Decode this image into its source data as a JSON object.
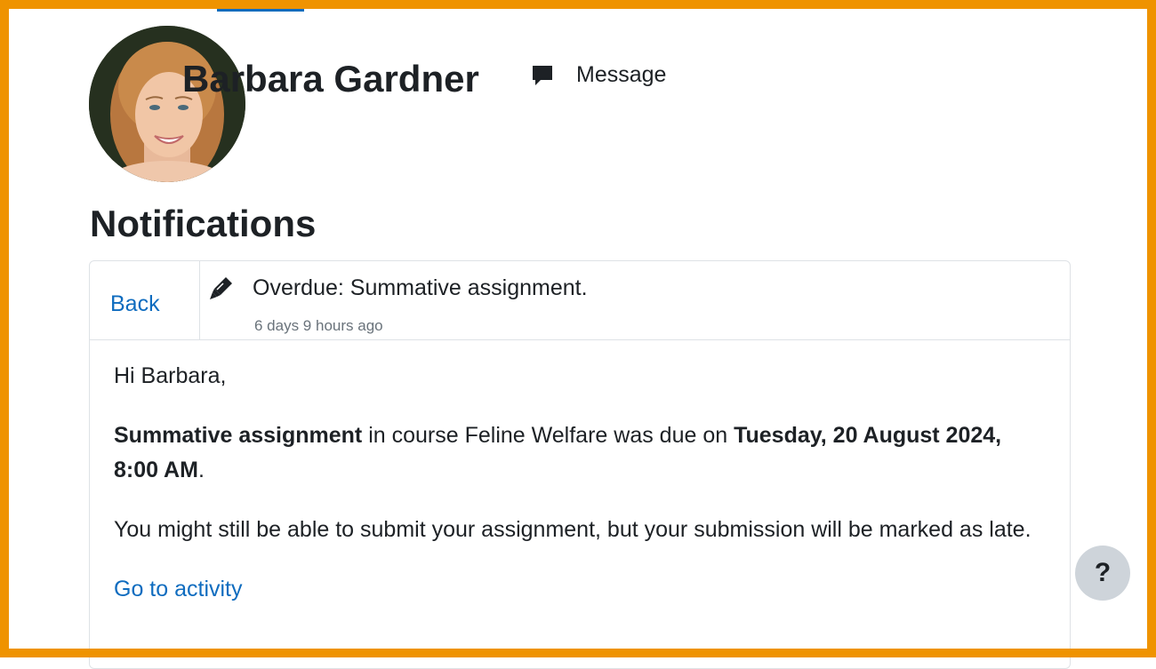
{
  "profile": {
    "name": "Barbara Gardner",
    "message_label": "Message",
    "avatar_icon": "profile-photo"
  },
  "page": {
    "title": "Notifications"
  },
  "notification": {
    "back_label": "Back",
    "icon": "assignment-pen-icon",
    "subject": "Overdue: Summative assignment.",
    "time": "6 days 9 hours ago",
    "greeting": "Hi Barbara,",
    "assignment_name": "Summative assignment",
    "course_text": " in course Feline Welfare was due on ",
    "due_date": "Tuesday, 20 August 2024, 8:00 AM",
    "after_date": ".",
    "late_text": "You might still be able to submit your assignment, but your submission will be marked as late.",
    "activity_link": "Go to activity"
  },
  "help": {
    "label": "?"
  },
  "colors": {
    "frame": "#ef9300",
    "link": "#0f6cbf",
    "muted": "#6a737b"
  }
}
